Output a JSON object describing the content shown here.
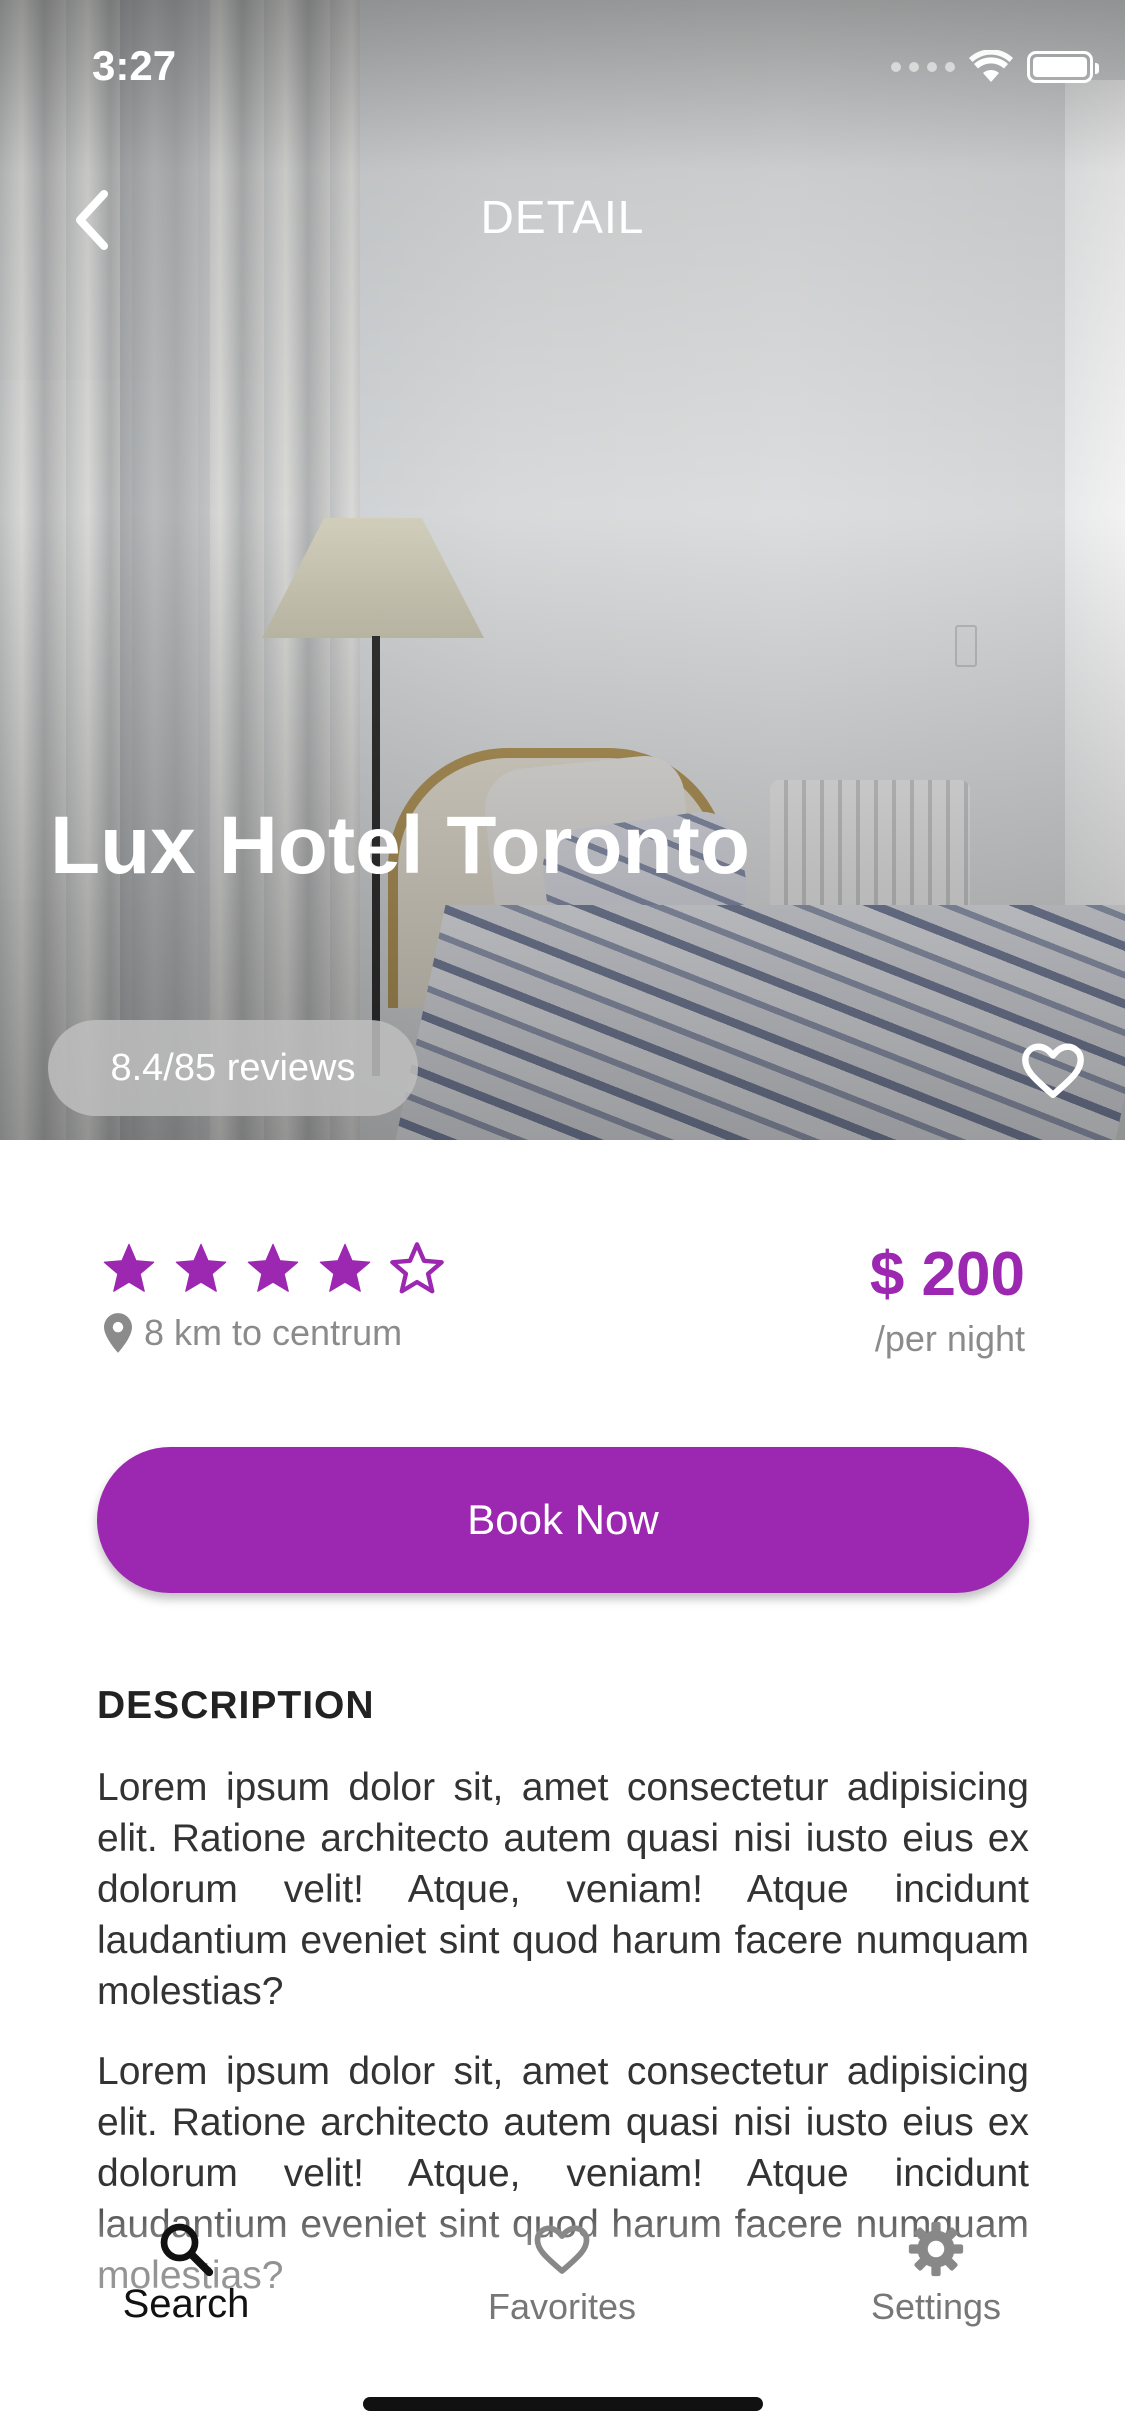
{
  "status_bar": {
    "time": "3:27"
  },
  "nav": {
    "title": "DETAIL"
  },
  "hotel": {
    "name": "Lux Hotel Toronto",
    "reviews": "8.4/85 reviews",
    "rating": 4,
    "rating_max": 5,
    "distance": "8 km to centrum",
    "price": "$ 200",
    "price_unit": "/per night"
  },
  "actions": {
    "book_label": "Book Now"
  },
  "description": {
    "heading": "DESCRIPTION",
    "paragraphs": [
      "Lorem ipsum dolor sit, amet consectetur adipisicing elit. Ratione architecto autem quasi nisi iusto eius ex dolorum velit! Atque, veniam! Atque incidunt laudantium eveniet sint quod harum facere numquam molestias?",
      "Lorem ipsum dolor sit, amet consectetur adipisicing elit. Ratione architecto autem quasi nisi iusto eius ex dolorum velit! Atque, veniam! Atque incidunt laudantium eveniet sint quod harum facere numquam molestias?"
    ]
  },
  "bottom_nav": {
    "items": [
      {
        "label": "Search",
        "icon": "search-icon",
        "active": true
      },
      {
        "label": "Favorites",
        "icon": "heart-outline-icon",
        "active": false
      },
      {
        "label": "Settings",
        "icon": "gear-icon",
        "active": false
      }
    ]
  },
  "colors": {
    "accent": "#9c27b0",
    "muted_text": "#8b8b8b",
    "pill_bg": "#bebebe"
  }
}
